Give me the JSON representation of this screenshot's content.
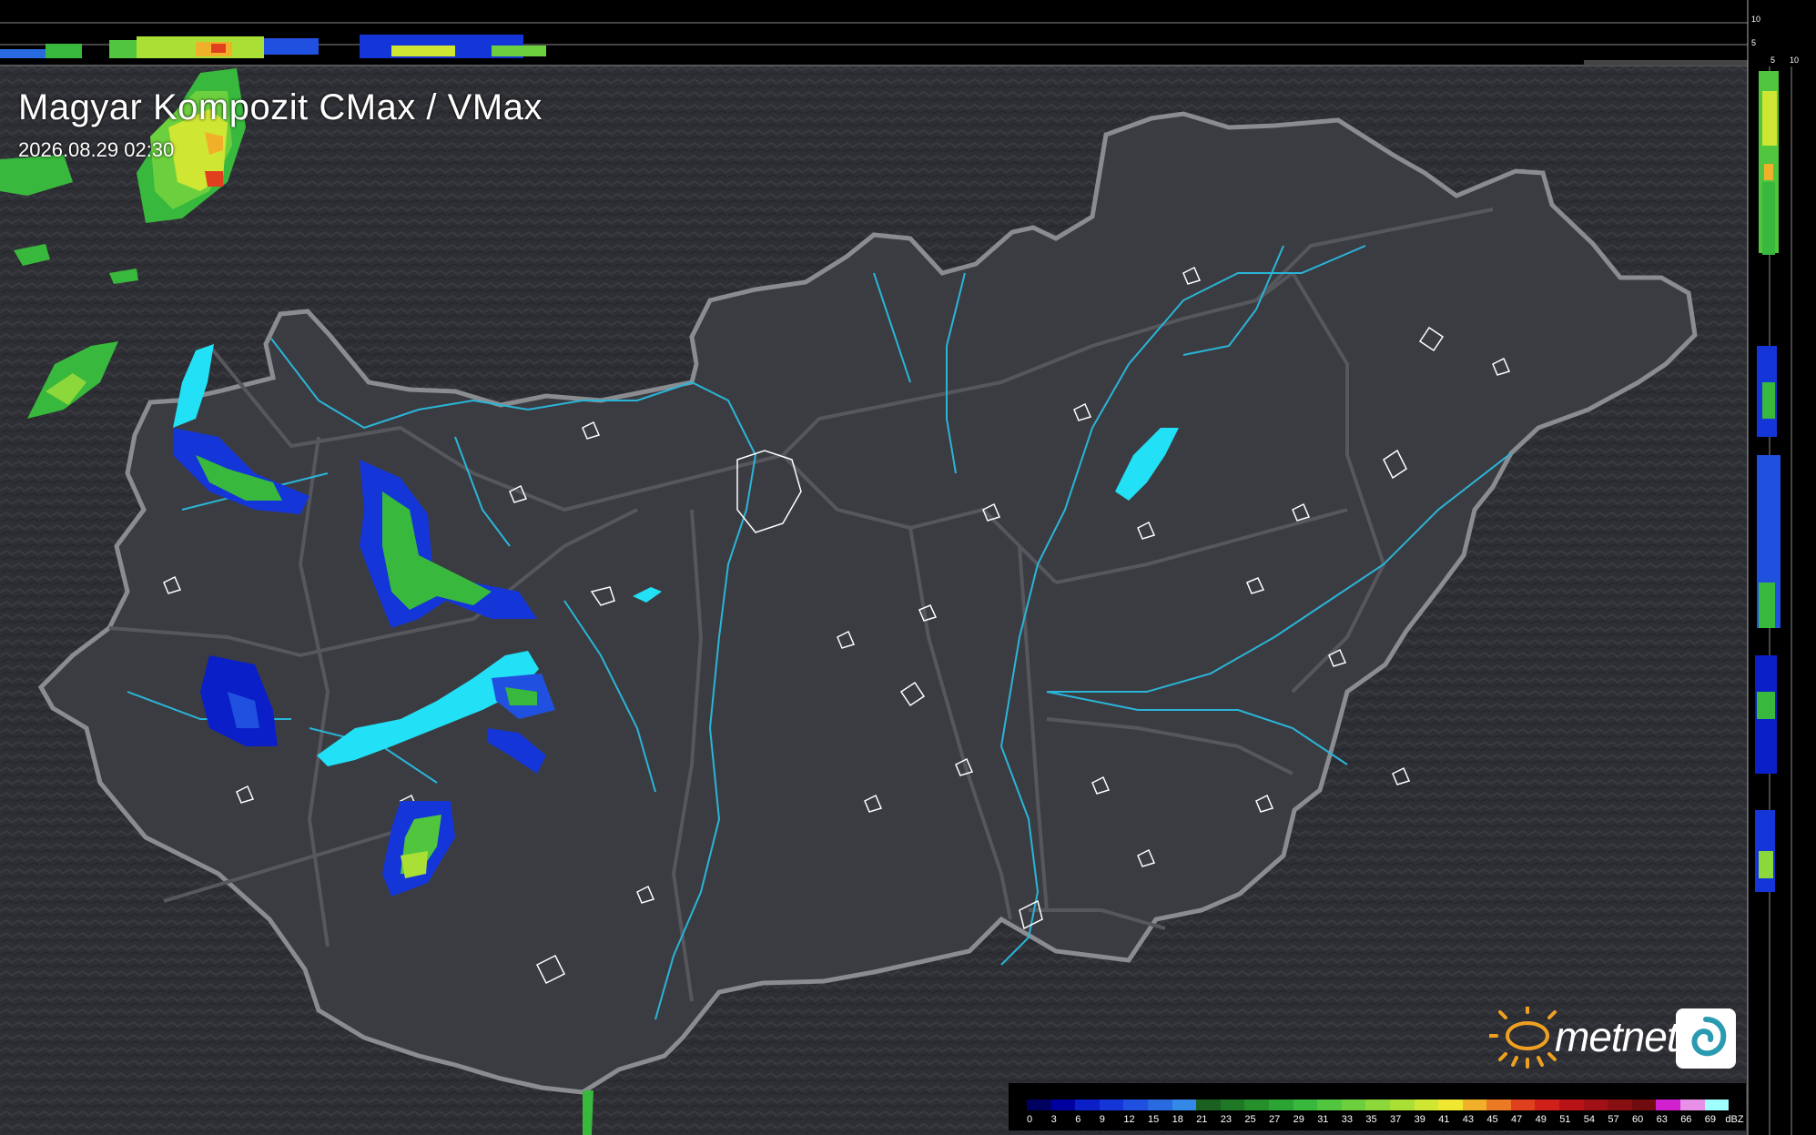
{
  "title": "Magyar Kompozit CMax / VMax",
  "timestamp": "2026.08.29 02:30",
  "logo": {
    "text": "metnet",
    "sun_color": "#f0a020",
    "box_icon": "swirl-icon"
  },
  "colors": {
    "background": "#2e2f34",
    "country_fill": "#3b3c42",
    "border": "#8a8c90",
    "rivers": "#2ab5d8",
    "lakes": "#22e0f5",
    "towns": "#ffffff"
  },
  "side_profile": {
    "top_labels": [
      "10",
      "5"
    ],
    "right_labels": [
      "5",
      "10"
    ]
  },
  "legend": {
    "unit": "dBZ",
    "values": [
      "0",
      "3",
      "6",
      "9",
      "12",
      "15",
      "18",
      "21",
      "23",
      "25",
      "27",
      "29",
      "31",
      "33",
      "35",
      "37",
      "39",
      "41",
      "43",
      "45",
      "47",
      "49",
      "51",
      "54",
      "57",
      "60",
      "63",
      "66",
      "69"
    ],
    "colors": [
      "#000060",
      "#0000a0",
      "#0b1fc8",
      "#1436d8",
      "#2050e0",
      "#2a6ae0",
      "#3488e8",
      "#1a6020",
      "#1f7826",
      "#258f2c",
      "#2ca434",
      "#38b83c",
      "#52c53e",
      "#6cd03e",
      "#8cd83a",
      "#aadf36",
      "#cfe632",
      "#f0e830",
      "#f0b02a",
      "#ec7a24",
      "#e0401e",
      "#d0201a",
      "#b81418",
      "#a01016",
      "#881012",
      "#700c10",
      "#d020d0",
      "#e890e8",
      "#a0ffff"
    ]
  }
}
